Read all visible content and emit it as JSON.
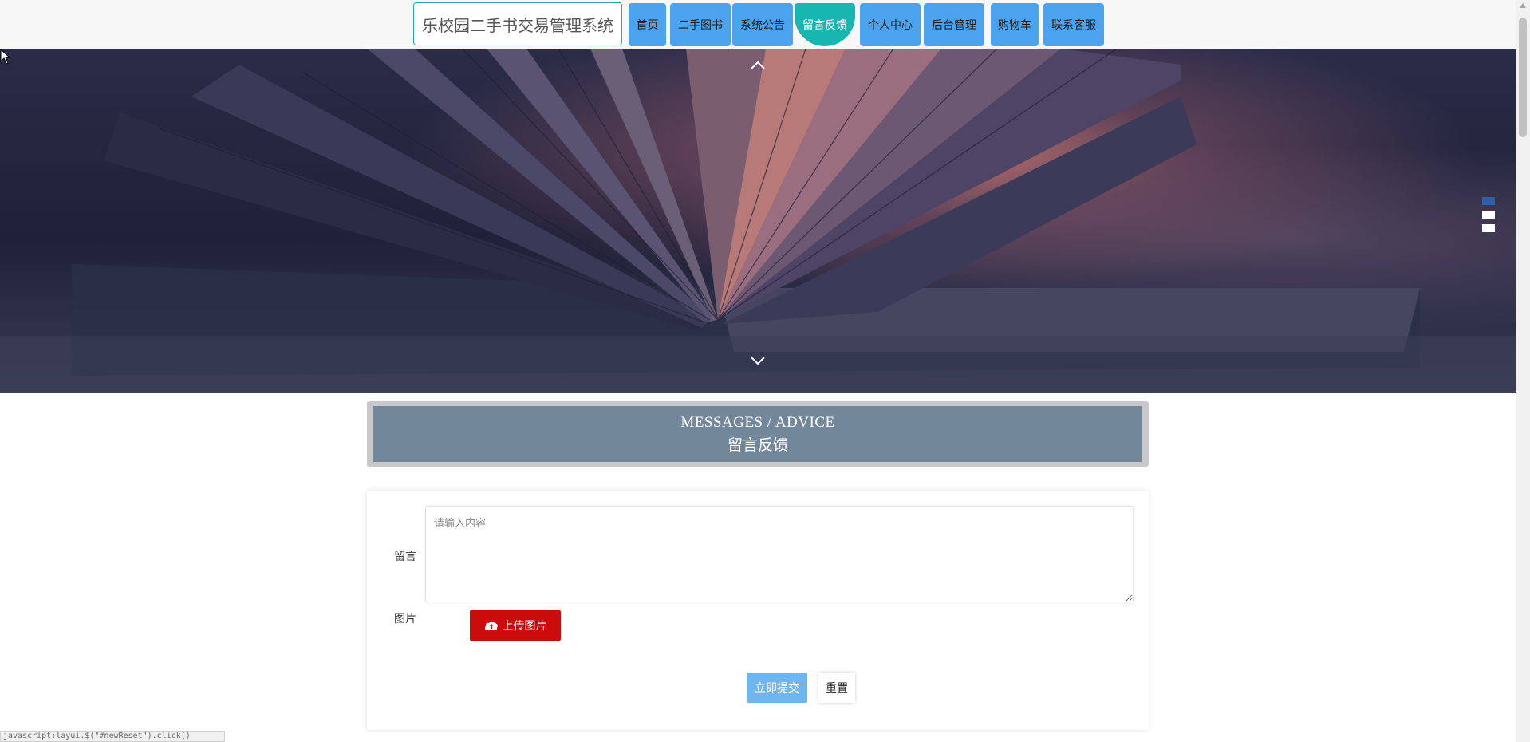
{
  "header": {
    "site_title": "乐校园二手书交易管理系统",
    "nav": [
      {
        "label": "首页",
        "active": false
      },
      {
        "label": "二手图书",
        "active": false
      },
      {
        "label": "系统公告",
        "active": false
      },
      {
        "label": "留言反馈",
        "active": true
      },
      {
        "label": "个人中心",
        "active": false
      },
      {
        "label": "后台管理",
        "active": false
      },
      {
        "label": "购物车",
        "active": false
      },
      {
        "label": "联系客服",
        "active": false
      }
    ]
  },
  "hero": {
    "prev_icon": "chevron-up-icon",
    "next_icon": "chevron-down-icon",
    "slides_count": 3,
    "active_slide": 1
  },
  "section": {
    "title_en": "MESSAGES / ADVICE",
    "title_cn": "留言反馈"
  },
  "form": {
    "message_label": "留言",
    "message_placeholder": "请输入内容",
    "message_value": "",
    "image_label": "图片",
    "upload_label": "上传图片",
    "upload_icon": "cloud-upload-icon",
    "submit_label": "立即提交",
    "reset_label": "重置"
  },
  "status": {
    "text": "javascript:layui.$(\"#newReset\").click()"
  },
  "colors": {
    "nav_button": "#4aa3ec",
    "nav_active": "#18b6b0",
    "section_header": "#73879a",
    "upload_button": "#cc0b0b",
    "submit_button": "#6fb6f0"
  }
}
